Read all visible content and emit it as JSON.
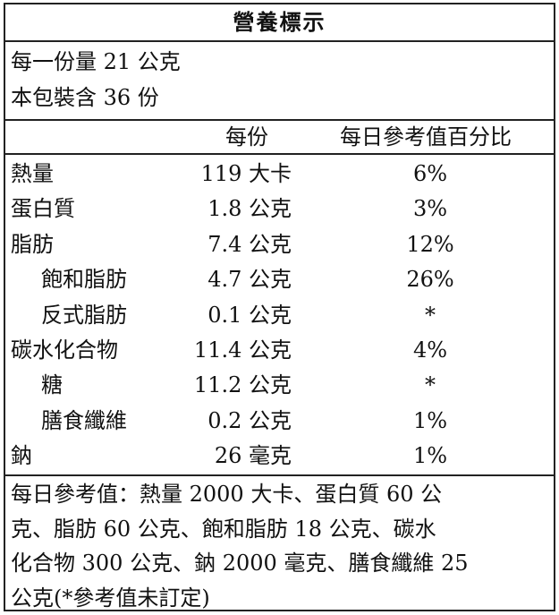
{
  "title": "營養標示",
  "serving_size": "每一份量 21 公克",
  "servings_per_package": "本包裝含 36 份",
  "headers": {
    "per_serving": "每份",
    "daily_value": "每日參考值百分比"
  },
  "rows": [
    {
      "name": "熱量",
      "amount": "119 大卡",
      "dv": "6%",
      "indent": false
    },
    {
      "name": "蛋白質",
      "amount": "1.8 公克",
      "dv": "3%",
      "indent": false
    },
    {
      "name": "脂肪",
      "amount": "7.4 公克",
      "dv": "12%",
      "indent": false
    },
    {
      "name": "飽和脂肪",
      "amount": "4.7 公克",
      "dv": "26%",
      "indent": true
    },
    {
      "name": "反式脂肪",
      "amount": "0.1 公克",
      "dv": "*",
      "indent": true
    },
    {
      "name": "碳水化合物",
      "amount": "11.4 公克",
      "dv": "4%",
      "indent": false
    },
    {
      "name": "糖",
      "amount": "11.2 公克",
      "dv": "*",
      "indent": true
    },
    {
      "name": "膳食纖維",
      "amount": "0.2 公克",
      "dv": "1%",
      "indent": true
    },
    {
      "name": "鈉",
      "amount": "26 毫克",
      "dv": "1%",
      "indent": false
    }
  ],
  "footnote_lines": [
    "每日參考值：熱量 2000 大卡、蛋白質 60 公",
    "克、脂肪 60 公克、飽和脂肪 18 公克、碳水",
    "化合物 300 公克、鈉 2000 毫克、膳食纖維 25",
    "公克(*參考值未訂定)"
  ]
}
